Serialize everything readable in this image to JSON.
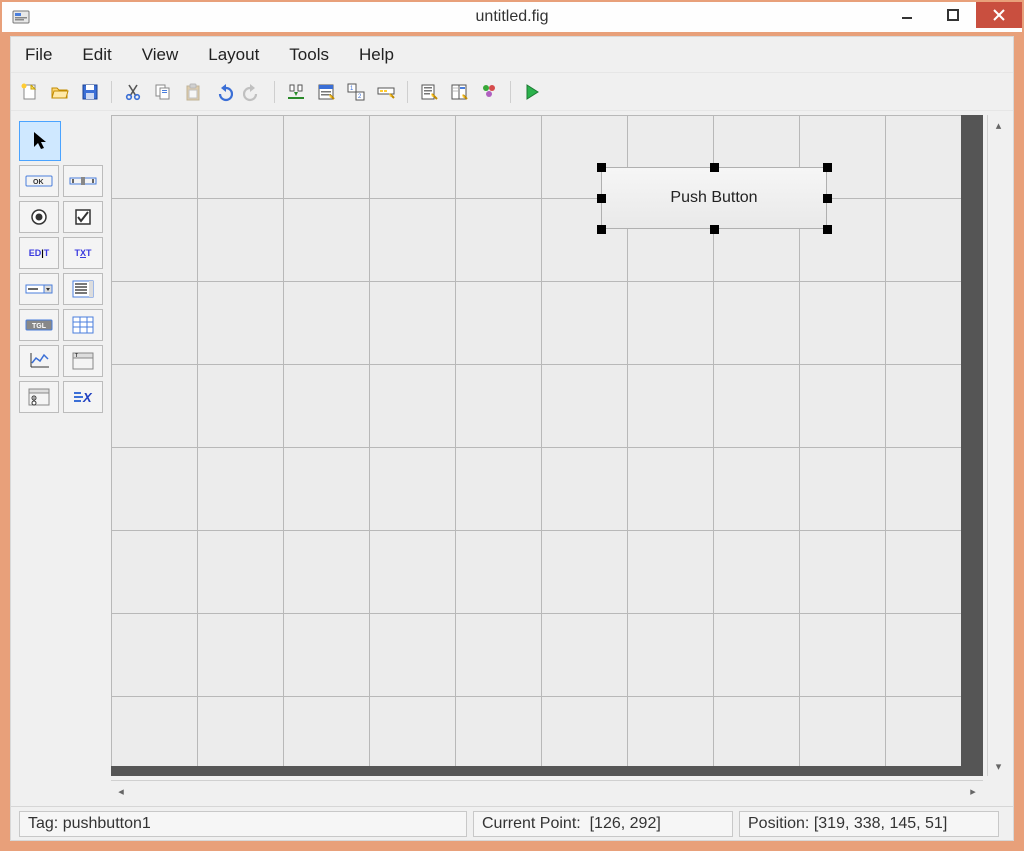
{
  "window": {
    "title": "untitled.fig"
  },
  "menu": {
    "file": "File",
    "edit": "Edit",
    "view": "View",
    "layout": "Layout",
    "tools": "Tools",
    "help": "Help"
  },
  "toolbar_icons": {
    "new": "new-file-icon",
    "open": "open-folder-icon",
    "save": "save-icon",
    "cut": "cut-icon",
    "copy": "copy-icon",
    "paste": "paste-icon",
    "undo": "undo-icon",
    "redo": "redo-icon",
    "align": "align-icon",
    "menu_editor": "menu-editor-icon",
    "tab_order": "tab-order-icon",
    "toolbar_editor": "toolbar-editor-icon",
    "editor": "editor-icon",
    "property_inspector": "property-inspector-icon",
    "object_browser": "object-browser-icon",
    "run": "run-icon"
  },
  "palette": {
    "select": "select-tool",
    "pushbutton": "OK",
    "slider": "slider",
    "radiobutton": "radio",
    "checkbox": "check",
    "edit": "ED|T",
    "text": "TXT",
    "popup": "popup",
    "listbox": "list",
    "toggle": "TGL",
    "table": "table",
    "axes": "axes",
    "panel": "panel",
    "buttongroup": "bgroup",
    "activex": "X"
  },
  "canvas": {
    "component_label": "Push Button"
  },
  "status": {
    "tag_label": "Tag:",
    "tag_value": "pushbutton1",
    "current_point_label": "Current Point:",
    "current_point_value": "[126, 292]",
    "position_label": "Position:",
    "position_value": "[319, 338, 145, 51]"
  }
}
